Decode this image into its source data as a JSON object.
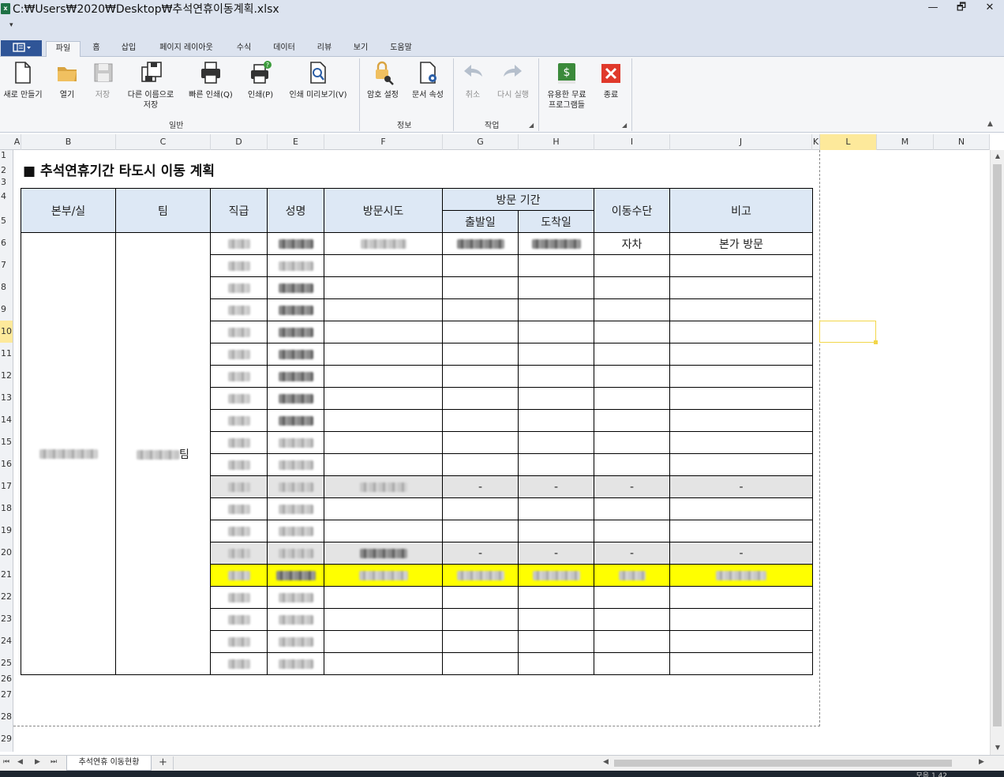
{
  "window": {
    "title": "C:₩Users₩2020₩Desktop₩추석연휴이동계획.xlsx",
    "app_icon": "excel-icon",
    "controls": {
      "minimize": "—",
      "restore": "🗗",
      "close": "✕"
    }
  },
  "quick_access": {
    "customize_glyph": "▾"
  },
  "ribbon_tabs": [
    {
      "label": "파일",
      "active": true
    },
    {
      "label": "홈"
    },
    {
      "label": "삽입"
    },
    {
      "label": "페이지 레이아웃"
    },
    {
      "label": "수식"
    },
    {
      "label": "데이터"
    },
    {
      "label": "리뷰"
    },
    {
      "label": "보기"
    },
    {
      "label": "도움말"
    }
  ],
  "ribbon": {
    "buttons": [
      {
        "label": "새로 만들기",
        "icon": "new-file-icon",
        "enabled": true
      },
      {
        "label": "열기",
        "icon": "open-folder-icon",
        "enabled": true
      },
      {
        "label": "저장",
        "icon": "save-icon",
        "enabled": false
      },
      {
        "label": "다른 이름으로 저장",
        "icon": "save-as-icon",
        "enabled": true
      },
      {
        "label": "빠른 인쇄(Q)",
        "icon": "quick-print-icon",
        "enabled": true
      },
      {
        "label": "인쇄(P)",
        "icon": "print-icon",
        "enabled": true
      },
      {
        "label": "인쇄 미리보기(V)",
        "icon": "print-preview-icon",
        "enabled": true
      },
      {
        "label": "암호 설정",
        "icon": "password-lock-icon",
        "enabled": true
      },
      {
        "label": "문서 속성",
        "icon": "document-properties-icon",
        "enabled": true
      },
      {
        "label": "취소",
        "icon": "undo-icon",
        "enabled": false
      },
      {
        "label": "다시 실행",
        "icon": "redo-icon",
        "enabled": false
      },
      {
        "label": "유용한 무료 프로그램들",
        "icon": "money-book-icon",
        "enabled": true
      },
      {
        "label": "종료",
        "icon": "exit-icon",
        "enabled": true
      }
    ],
    "groups": [
      "일반",
      "정보",
      "작업"
    ]
  },
  "columns": [
    "A",
    "B",
    "C",
    "D",
    "E",
    "F",
    "G",
    "H",
    "I",
    "J",
    "K",
    "L",
    "M",
    "N"
  ],
  "selected_column": "L",
  "rows": [
    "1",
    "2",
    "3",
    "4",
    "5",
    "6",
    "7",
    "8",
    "9",
    "10",
    "11",
    "12",
    "13",
    "14",
    "15",
    "16",
    "17",
    "18",
    "19",
    "20",
    "21",
    "22",
    "23",
    "24",
    "25",
    "26",
    "27",
    "28",
    "29"
  ],
  "selected_row": "10",
  "sheet": {
    "title": "■ 추석연휴기간 타도시 이동 계획",
    "headers": {
      "dept": "본부/실",
      "team": "팀",
      "rank": "직급",
      "name": "성명",
      "visit_city": "방문시도",
      "visit_period": "방문 기간",
      "depart": "출발일",
      "arrive": "도착일",
      "transport": "이동수단",
      "remark": "비고"
    },
    "team_suffix": "팀",
    "first_row": {
      "transport": "자차",
      "remark": "본가 방문"
    },
    "dash": "-"
  },
  "sheet_tabs": [
    {
      "label": "추석연휴 이동현황",
      "active": true
    }
  ],
  "add_sheet": "+",
  "nav": {
    "first": "⏮",
    "prev": "◀",
    "next": "▶",
    "last": "⏭"
  },
  "status": {
    "right_text": "모음 1.42"
  },
  "colors": {
    "header_fill": "#dde8f5",
    "highlight_row": "#ffff00",
    "gray_row": "#e4e4e4",
    "selection": "#f2d64a"
  }
}
